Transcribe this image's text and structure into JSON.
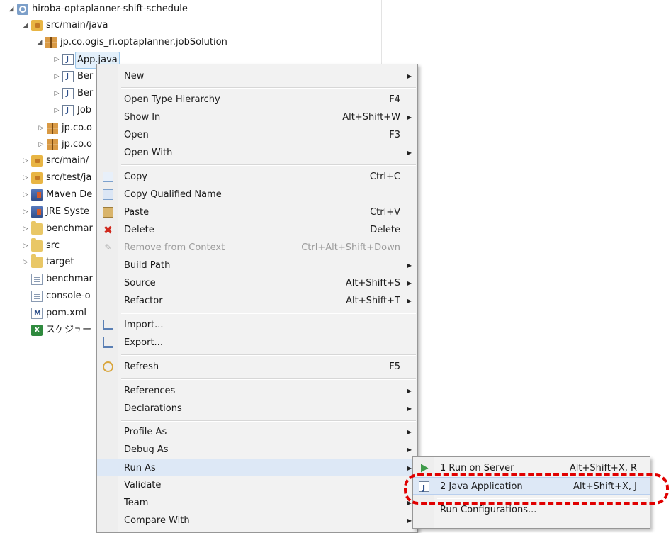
{
  "tree": {
    "items": [
      {
        "toggle": "◢",
        "icon": "project-icon",
        "label": "hiroba-optaplanner-shift-schedule"
      },
      {
        "toggle": "◢",
        "icon": "source-folder-icon",
        "label": "src/main/java"
      },
      {
        "toggle": "◢",
        "icon": "package-icon",
        "label": "jp.co.ogis_ri.optaplanner.jobSolution"
      },
      {
        "toggle": "▷",
        "icon": "java-file-icon",
        "label": "App.java"
      },
      {
        "toggle": "▷",
        "icon": "java-file-icon",
        "label": "Ber"
      },
      {
        "toggle": "▷",
        "icon": "java-file-icon",
        "label": "Ber"
      },
      {
        "toggle": "▷",
        "icon": "java-file-icon",
        "label": "Job"
      },
      {
        "toggle": "▷",
        "icon": "package-icon",
        "label": "jp.co.o"
      },
      {
        "toggle": "▷",
        "icon": "package-icon",
        "label": "jp.co.o"
      },
      {
        "toggle": "▷",
        "icon": "source-folder-icon",
        "label": "src/main/"
      },
      {
        "toggle": "▷",
        "icon": "source-folder-icon",
        "label": "src/test/ja"
      },
      {
        "toggle": "▷",
        "icon": "library-icon",
        "label": "Maven De"
      },
      {
        "toggle": "▷",
        "icon": "library-icon",
        "label": "JRE Syste"
      },
      {
        "toggle": "▷",
        "icon": "folder-icon",
        "label": "benchmar"
      },
      {
        "toggle": "▷",
        "icon": "folder-icon",
        "label": "src"
      },
      {
        "toggle": "▷",
        "icon": "folder-icon",
        "label": "target"
      },
      {
        "toggle": "",
        "icon": "file-icon",
        "label": "benchmar"
      },
      {
        "toggle": "",
        "icon": "file-icon",
        "label": "console-o"
      },
      {
        "toggle": "",
        "icon": "pom-file-icon",
        "label": "pom.xml"
      },
      {
        "toggle": "",
        "icon": "excel-file-icon",
        "label": "スケジュー"
      }
    ]
  },
  "context_menu": {
    "items": [
      {
        "label": "New",
        "shortcut": "",
        "submenu": true
      },
      {
        "label": "Open Type Hierarchy",
        "shortcut": "F4",
        "submenu": false
      },
      {
        "label": "Show In",
        "shortcut": "Alt+Shift+W",
        "submenu": true
      },
      {
        "label": "Open",
        "shortcut": "F3",
        "submenu": false
      },
      {
        "label": "Open With",
        "shortcut": "",
        "submenu": true
      },
      {
        "label": "Copy",
        "shortcut": "Ctrl+C",
        "submenu": false
      },
      {
        "label": "Copy Qualified Name",
        "shortcut": "",
        "submenu": false
      },
      {
        "label": "Paste",
        "shortcut": "Ctrl+V",
        "submenu": false
      },
      {
        "label": "Delete",
        "shortcut": "Delete",
        "submenu": false
      },
      {
        "label": "Remove from Context",
        "shortcut": "Ctrl+Alt+Shift+Down",
        "submenu": false
      },
      {
        "label": "Build Path",
        "shortcut": "",
        "submenu": true
      },
      {
        "label": "Source",
        "shortcut": "Alt+Shift+S",
        "submenu": true
      },
      {
        "label": "Refactor",
        "shortcut": "Alt+Shift+T",
        "submenu": true
      },
      {
        "label": "Import...",
        "shortcut": "",
        "submenu": false
      },
      {
        "label": "Export...",
        "shortcut": "",
        "submenu": false
      },
      {
        "label": "Refresh",
        "shortcut": "F5",
        "submenu": false
      },
      {
        "label": "References",
        "shortcut": "",
        "submenu": true
      },
      {
        "label": "Declarations",
        "shortcut": "",
        "submenu": true
      },
      {
        "label": "Profile As",
        "shortcut": "",
        "submenu": true
      },
      {
        "label": "Debug As",
        "shortcut": "",
        "submenu": true
      },
      {
        "label": "Run As",
        "shortcut": "",
        "submenu": true
      },
      {
        "label": "Validate",
        "shortcut": "",
        "submenu": false
      },
      {
        "label": "Team",
        "shortcut": "",
        "submenu": true
      },
      {
        "label": "Compare With",
        "shortcut": "",
        "submenu": true
      }
    ],
    "arrow": "▶"
  },
  "run_as_submenu": {
    "items": [
      {
        "label": "1 Run on Server",
        "shortcut": "Alt+Shift+X, R"
      },
      {
        "label": "2 Java Application",
        "shortcut": "Alt+Shift+X, J"
      },
      {
        "label": "Run Configurations...",
        "shortcut": ""
      }
    ]
  },
  "colors": {
    "highlight": "#e00000",
    "menu_background": "#f2f2f2",
    "hover_background": "#dde8f6"
  }
}
